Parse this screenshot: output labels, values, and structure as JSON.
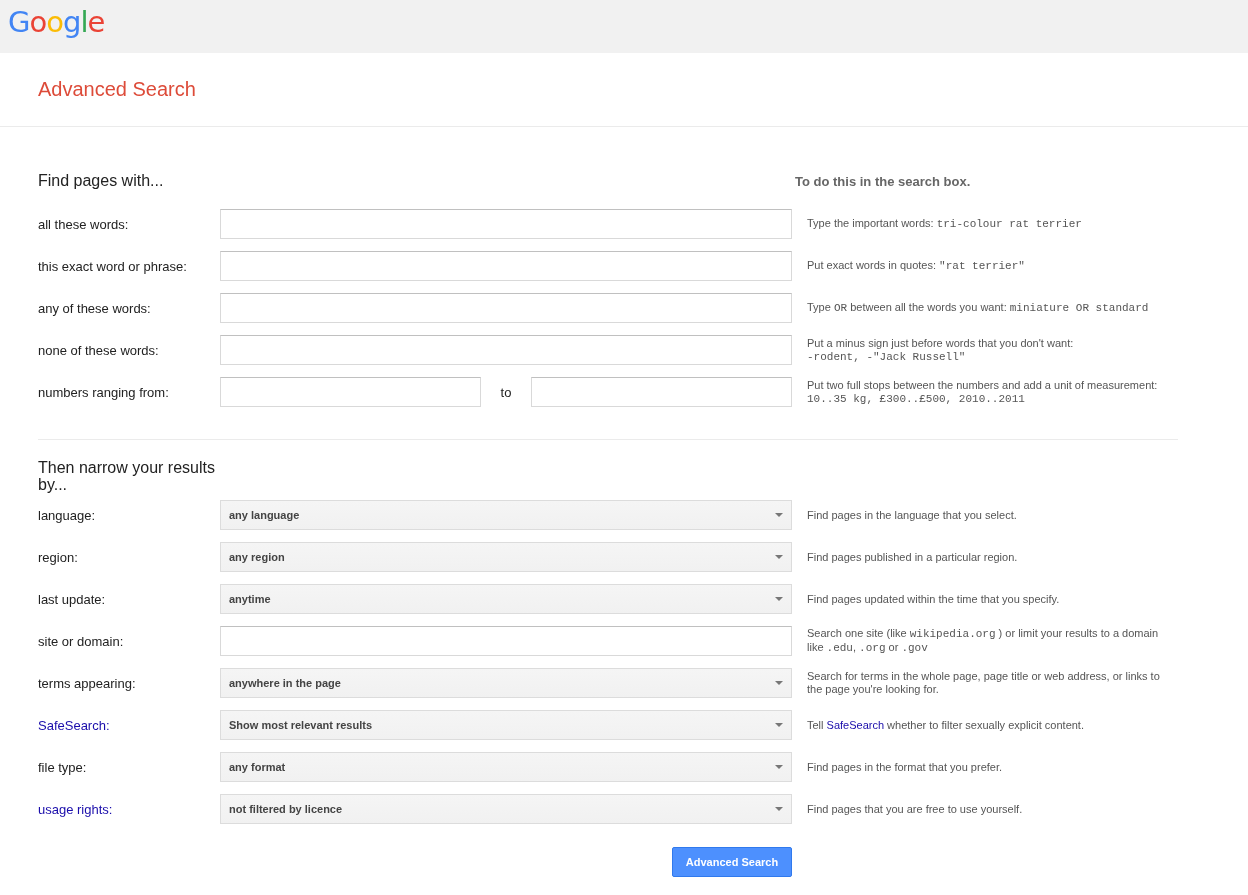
{
  "header": {
    "logo": "Google"
  },
  "title": "Advanced Search",
  "find_section": {
    "heading": "Find pages with...",
    "hint_heading": "To do this in the search box.",
    "rows": [
      {
        "label": "all these words:",
        "label_link": false,
        "kind": "text",
        "hint": [
          [
            {
              "kind": "text",
              "text": "Type the important words: "
            },
            {
              "kind": "code",
              "text": "tri-colour rat terrier"
            }
          ]
        ]
      },
      {
        "label": "this exact word or phrase:",
        "label_link": false,
        "kind": "text",
        "hint": [
          [
            {
              "kind": "text",
              "text": "Put exact words in quotes: "
            },
            {
              "kind": "code",
              "text": "\"rat terrier\""
            }
          ]
        ]
      },
      {
        "label": "any of these words:",
        "label_link": false,
        "kind": "text",
        "hint": [
          [
            {
              "kind": "text",
              "text": "Type "
            },
            {
              "kind": "code",
              "text": "OR"
            },
            {
              "kind": "text",
              "text": " between all the words you want: "
            },
            {
              "kind": "code",
              "text": "miniature OR standard"
            }
          ]
        ]
      },
      {
        "label": "none of these words:",
        "label_link": false,
        "kind": "text",
        "hint": [
          [
            {
              "kind": "text",
              "text": "Put a minus sign just before words that you don't want:"
            }
          ],
          [
            {
              "kind": "code",
              "text": "-rodent, -\"Jack Russell\""
            }
          ]
        ]
      },
      {
        "label": "numbers ranging from:",
        "label_link": false,
        "kind": "range",
        "separator": "to",
        "hint": [
          [
            {
              "kind": "text",
              "text": "Put two full stops between the numbers and add a unit of measurement:"
            }
          ],
          [
            {
              "kind": "code",
              "text": "10..35 kg, £300..£500, 2010..2011"
            }
          ]
        ]
      }
    ]
  },
  "narrow_section": {
    "heading": "Then narrow your results by...",
    "rows": [
      {
        "label": "language:",
        "label_link": false,
        "kind": "select",
        "value": "any language",
        "hint": [
          [
            {
              "kind": "text",
              "text": "Find pages in the language that you select."
            }
          ]
        ]
      },
      {
        "label": "region:",
        "label_link": false,
        "kind": "select",
        "value": "any region",
        "hint": [
          [
            {
              "kind": "text",
              "text": "Find pages published in a particular region."
            }
          ]
        ]
      },
      {
        "label": "last update:",
        "label_link": false,
        "kind": "select",
        "value": "anytime",
        "hint": [
          [
            {
              "kind": "text",
              "text": "Find pages updated within the time that you specify."
            }
          ]
        ]
      },
      {
        "label": "site or domain:",
        "label_link": false,
        "kind": "text",
        "hint": [
          [
            {
              "kind": "text",
              "text": "Search one site (like "
            },
            {
              "kind": "code",
              "text": "wikipedia.org"
            },
            {
              "kind": "text",
              "text": " ) or limit your results to a domain"
            }
          ],
          [
            {
              "kind": "text",
              "text": "like "
            },
            {
              "kind": "code",
              "text": ".edu"
            },
            {
              "kind": "text",
              "text": ", "
            },
            {
              "kind": "code",
              "text": ".org"
            },
            {
              "kind": "text",
              "text": " or "
            },
            {
              "kind": "code",
              "text": ".gov"
            }
          ]
        ]
      },
      {
        "label": "terms appearing:",
        "label_link": false,
        "kind": "select",
        "value": "anywhere in the page",
        "hint": [
          [
            {
              "kind": "text",
              "text": "Search for terms in the whole page, page title or web address, or links to"
            }
          ],
          [
            {
              "kind": "text",
              "text": "the page you're looking for."
            }
          ]
        ]
      },
      {
        "label": "SafeSearch:",
        "label_link": true,
        "kind": "select",
        "value": "Show most relevant results",
        "hint": [
          [
            {
              "kind": "text",
              "text": "Tell "
            },
            {
              "kind": "link",
              "text": "SafeSearch"
            },
            {
              "kind": "text",
              "text": " whether to filter sexually explicit content."
            }
          ]
        ]
      },
      {
        "label": "file type:",
        "label_link": false,
        "kind": "select",
        "value": "any format",
        "hint": [
          [
            {
              "kind": "text",
              "text": "Find pages in the format that you prefer."
            }
          ]
        ]
      },
      {
        "label": "usage rights:",
        "label_link": true,
        "kind": "select",
        "value": "not filtered by licence",
        "hint": [
          [
            {
              "kind": "text",
              "text": "Find pages that you are free to use yourself."
            }
          ]
        ]
      }
    ]
  },
  "submit_button": "Advanced Search"
}
